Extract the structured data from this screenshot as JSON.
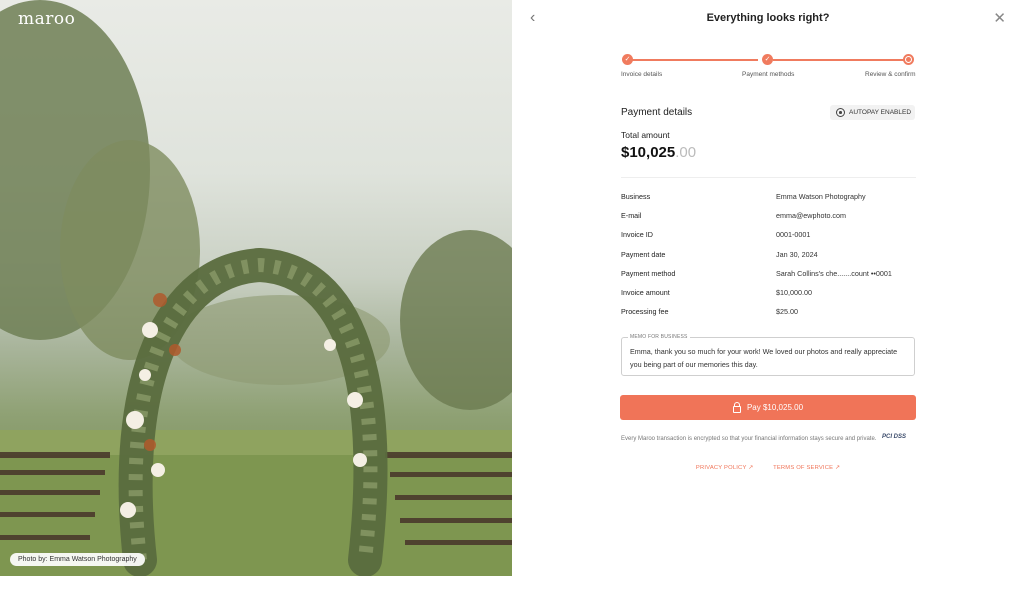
{
  "brand": {
    "logo_text": "maroo",
    "accent": "#f07458"
  },
  "photo": {
    "credit": "Photo by: Emma Watson Photography"
  },
  "header": {
    "title": "Everything looks right?",
    "back_icon": "chevron-left-icon",
    "close_icon": "close-icon"
  },
  "stepper": {
    "steps": [
      {
        "label": "Invoice details",
        "state": "done"
      },
      {
        "label": "Payment methods",
        "state": "done"
      },
      {
        "label": "Review & confirm",
        "state": "current"
      }
    ]
  },
  "payment": {
    "section_title": "Payment details",
    "autopay_label": "AUTOPAY ENABLED",
    "total_label": "Total amount",
    "total_main": "$10,025",
    "total_cents": ".00",
    "rows": [
      {
        "key": "Business",
        "value": "Emma Watson Photography"
      },
      {
        "key": "E-mail",
        "value": "emma@ewphoto.com"
      },
      {
        "key": "Invoice ID",
        "value": "0001-0001"
      },
      {
        "key": "Payment date",
        "value": "Jan 30, 2024"
      },
      {
        "key": "Payment method",
        "value": "Sarah Collins's che.......count ••0001"
      },
      {
        "key": "Invoice amount",
        "value": "$10,000.00"
      },
      {
        "key": "Processing fee",
        "value": "$25.00"
      }
    ]
  },
  "memo": {
    "label": "MEMO FOR BUSINESS",
    "text": "Emma, thank you so much for your work! We loved our photos and really appreciate you being part of our memories this day."
  },
  "pay_button": {
    "label": "Pay $10,025.00"
  },
  "footer": {
    "secure_text": "Every Maroo transaction is encrypted so that your financial information stays secure and private.",
    "badge_text": "PCI DSS",
    "privacy_label": "PRIVACY POLICY ↗",
    "terms_label": "TERMS OF SERVICE ↗"
  }
}
